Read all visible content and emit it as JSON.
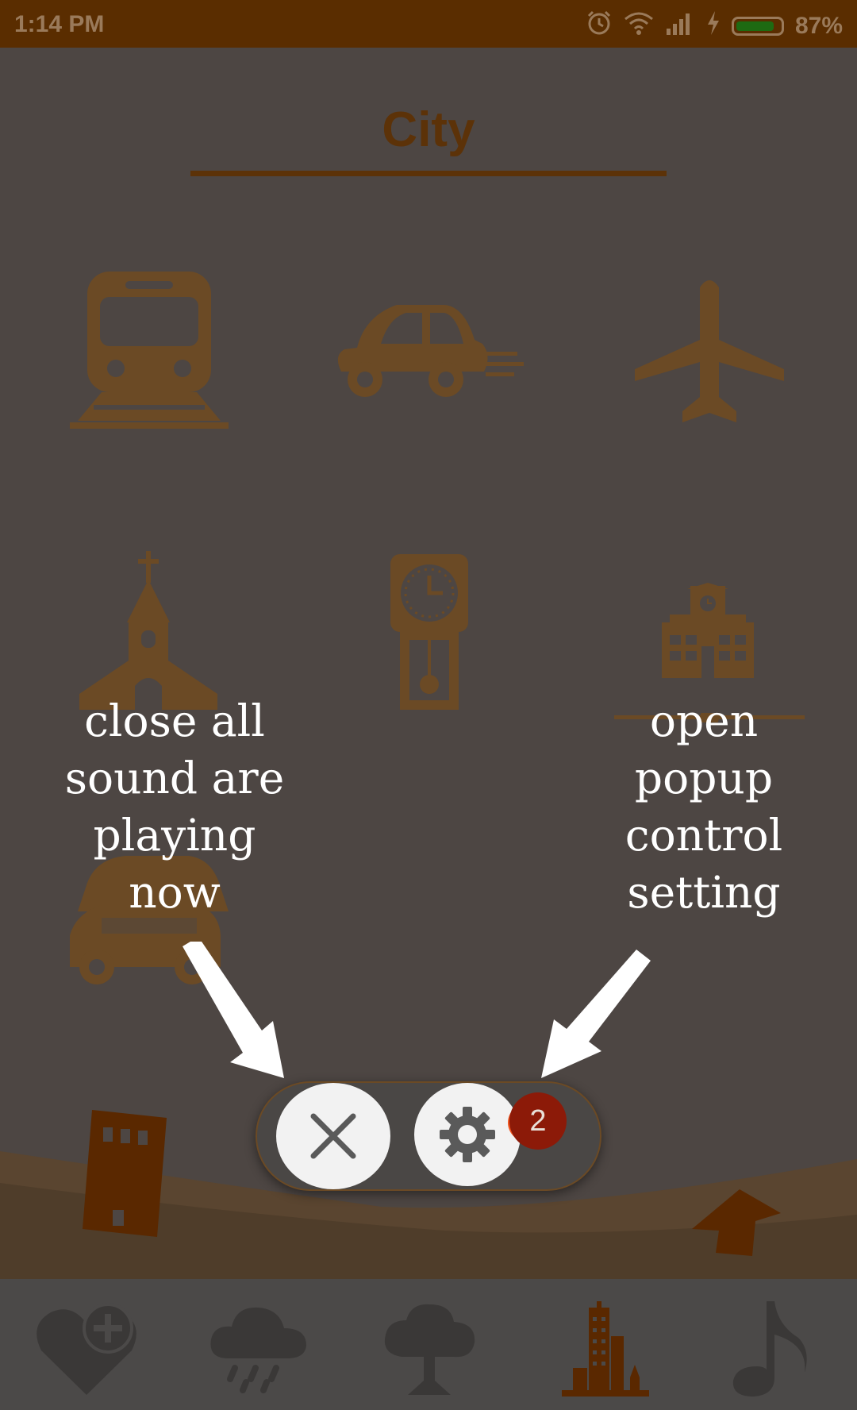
{
  "status_bar": {
    "time": "1:14 PM",
    "battery_percent": "87%",
    "battery_level": 0.87,
    "icons": [
      "alarm-icon",
      "wifi-icon",
      "signal-icon",
      "charging-icon",
      "battery-icon"
    ]
  },
  "header": {
    "title": "City"
  },
  "sounds": [
    {
      "name": "train-icon"
    },
    {
      "name": "car-icon"
    },
    {
      "name": "airplane-icon"
    },
    {
      "name": "church-icon"
    },
    {
      "name": "clock-icon"
    },
    {
      "name": "school-icon"
    },
    {
      "name": "car-traffic-icon"
    }
  ],
  "help_overlay": {
    "left_text": [
      "close all",
      "sound are",
      "playing",
      "now"
    ],
    "right_text": [
      "open",
      "popup",
      "control",
      "setting"
    ]
  },
  "control_pill": {
    "close_all_icon": "close-icon",
    "settings_icon": "gear-icon",
    "badge_count": "2"
  },
  "bottom_nav": {
    "items": [
      {
        "name": "favorites-add-icon"
      },
      {
        "name": "rain-icon"
      },
      {
        "name": "tree-icon"
      },
      {
        "name": "city-icon",
        "selected": true
      },
      {
        "name": "music-note-icon"
      }
    ]
  },
  "colors": {
    "accent": "#5c3208",
    "status_bar": "#5a2d00",
    "badge": "#8c1a08",
    "selected_nav": "#5a2800"
  }
}
